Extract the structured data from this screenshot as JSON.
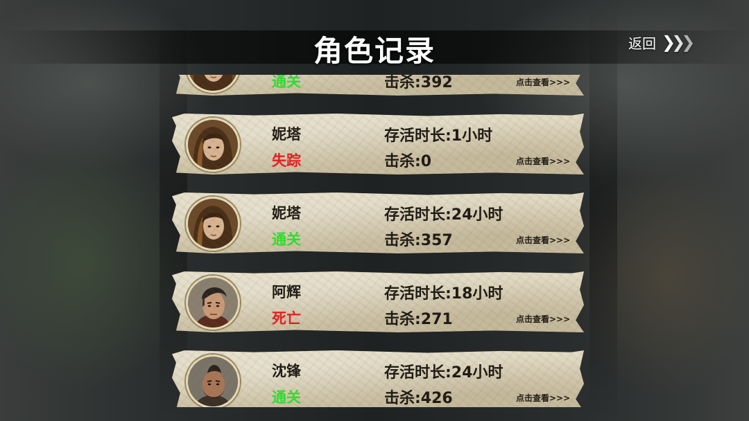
{
  "header": {
    "title": "角色记录",
    "back_label": "返回",
    "back_icon": "chevron-right-triple-icon"
  },
  "colors": {
    "cleared": "#2ee02e",
    "missing": "#e81e1e",
    "dead": "#e81e1e",
    "text": "#1e1a14"
  },
  "records": [
    {
      "name": "",
      "status": "通关",
      "status_type": "cleared",
      "survival": "",
      "kills": "击杀:392",
      "view": "点击查看>>>",
      "portrait": "female-long-hair"
    },
    {
      "name": "妮塔",
      "status": "失踪",
      "status_type": "missing",
      "survival": "存活时长:1小时",
      "kills": "击杀:0",
      "view": "点击查看>>>",
      "portrait": "female-long-hair"
    },
    {
      "name": "妮塔",
      "status": "通关",
      "status_type": "cleared",
      "survival": "存活时长:24小时",
      "kills": "击杀:357",
      "view": "点击查看>>>",
      "portrait": "female-long-hair"
    },
    {
      "name": "阿辉",
      "status": "死亡",
      "status_type": "dead",
      "survival": "存活时长:18小时",
      "kills": "击杀:271",
      "view": "点击查看>>>",
      "portrait": "male-undercut"
    },
    {
      "name": "沈锋",
      "status": "通关",
      "status_type": "cleared",
      "survival": "存活时长:24小时",
      "kills": "击杀:426",
      "view": "点击查看>>>",
      "portrait": "male-mohawk"
    }
  ]
}
